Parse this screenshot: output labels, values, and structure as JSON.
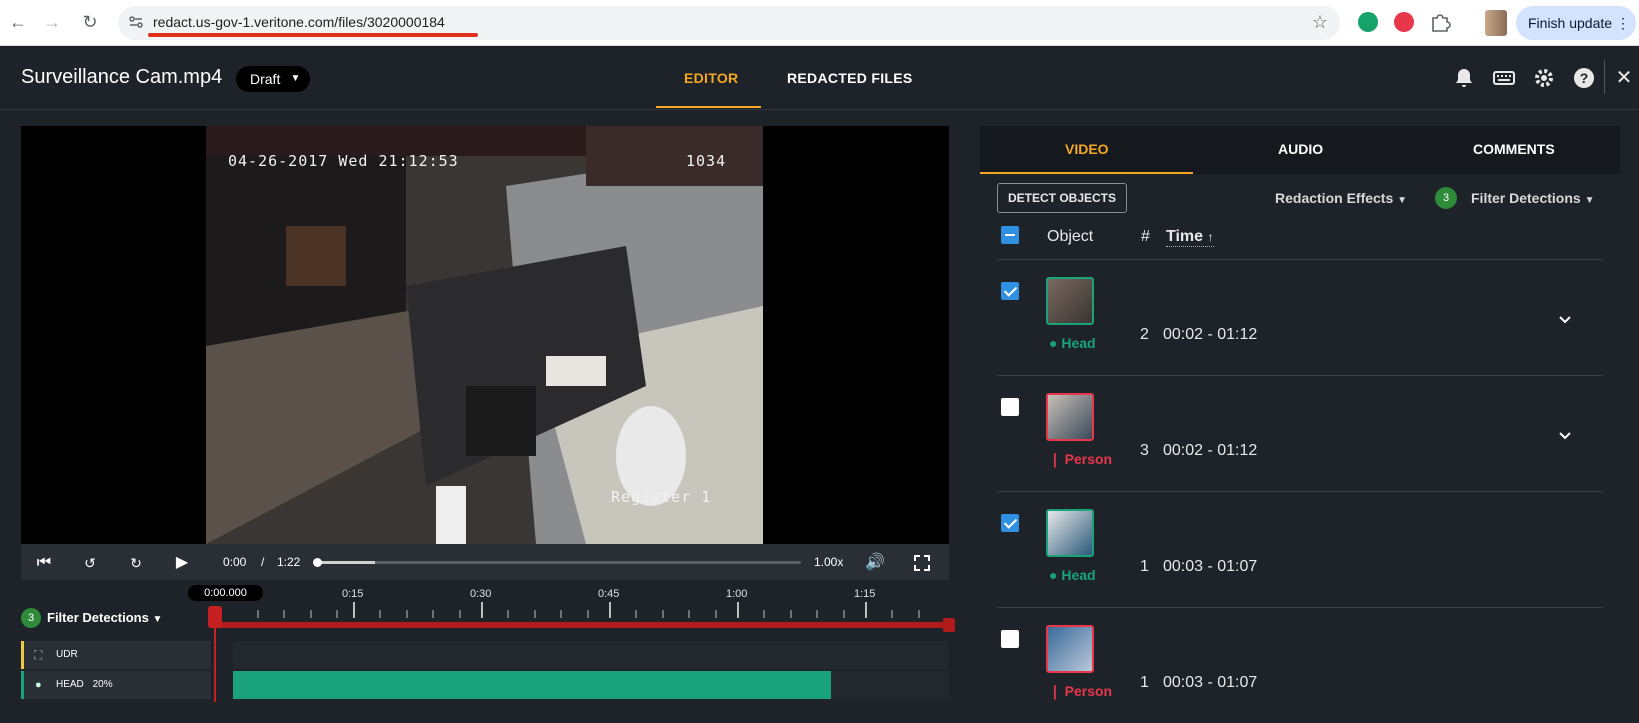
{
  "browser": {
    "url": "redact.us-gov-1.veritone.com/files/3020000184",
    "finish_update": "Finish update"
  },
  "header": {
    "file_title": "Surveillance Cam.mp4",
    "status": "Draft",
    "tabs": [
      {
        "label": "EDITOR",
        "active": true
      },
      {
        "label": "REDACTED FILES",
        "active": false
      }
    ]
  },
  "video": {
    "osd_datetime": "04-26-2017 Wed 21:12:53",
    "osd_number": "1034",
    "osd_register": "Register 1",
    "current_time": "0:00",
    "separator": "/",
    "duration": "1:22",
    "speed": "1.00x",
    "buffered": 0.12,
    "played": 0.0
  },
  "timeline": {
    "filter_count": "3",
    "filter_label": "Filter Detections",
    "playhead_time": "0:00.000",
    "ticks": [
      "0:15",
      "0:30",
      "0:45",
      "1:00",
      "1:15"
    ],
    "tracks": [
      {
        "label": "UDR",
        "color": "#f2c744"
      },
      {
        "label": "HEAD",
        "percent": "20%",
        "color": "#1aa37a",
        "bar_start": 0.0,
        "bar_end": 0.835
      }
    ]
  },
  "panel": {
    "tabs": [
      {
        "label": "VIDEO",
        "active": true
      },
      {
        "label": "AUDIO",
        "active": false
      },
      {
        "label": "COMMENTS",
        "active": false
      }
    ],
    "detect_objects": "DETECT OBJECTS",
    "redaction_effects": "Redaction Effects",
    "filter_count": "3",
    "filter_label": "Filter Detections",
    "columns": {
      "object": "Object",
      "num": "#",
      "time": "Time"
    },
    "rows": [
      {
        "checked": true,
        "type": "Head",
        "num": "2",
        "time": "00:02 - 01:12",
        "expandable": true
      },
      {
        "checked": false,
        "type": "Person",
        "num": "3",
        "time": "00:02 - 01:12",
        "expandable": true
      },
      {
        "checked": true,
        "type": "Head",
        "num": "1",
        "time": "00:03 - 01:07",
        "expandable": false
      },
      {
        "checked": false,
        "type": "Person",
        "num": "1",
        "time": "00:03 - 01:07",
        "expandable": false
      }
    ],
    "colors": {
      "head": "#1aa37a",
      "person": "#e8364b",
      "accent": "#f5a623",
      "check": "#2f8fe0"
    }
  }
}
